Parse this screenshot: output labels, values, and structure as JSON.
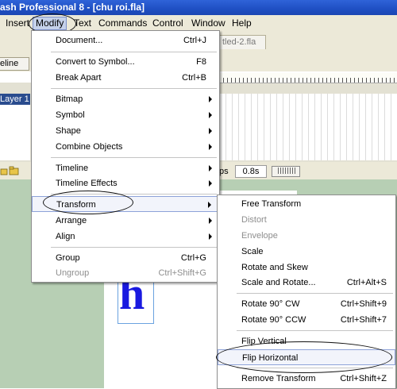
{
  "window": {
    "title": "ash Professional 8 - [chu roi.fla]"
  },
  "menubar": {
    "items": [
      "Insert",
      "Modify",
      "Text",
      "Commands",
      "Control",
      "Window",
      "Help"
    ],
    "active": "Modify"
  },
  "document_tab": "tled-2.fla",
  "timeline_button": "eline",
  "layer_label": "Layer 1",
  "status": {
    "fps_prefix": "ps",
    "fps_value": "0.8s"
  },
  "stage": {
    "letter": "h",
    "letter_color": "#1919e0"
  },
  "modify_menu": {
    "items": [
      {
        "label": "Document...",
        "shortcut": "Ctrl+J"
      },
      {
        "label": "Convert to Symbol...",
        "shortcut": "F8"
      },
      {
        "label": "Break Apart",
        "shortcut": "Ctrl+B"
      },
      {
        "label": "Bitmap",
        "submenu": true
      },
      {
        "label": "Symbol",
        "submenu": true
      },
      {
        "label": "Shape",
        "submenu": true
      },
      {
        "label": "Combine Objects",
        "submenu": true
      },
      {
        "label": "Timeline",
        "submenu": true
      },
      {
        "label": "Timeline Effects",
        "submenu": true
      },
      {
        "label": "Transform",
        "submenu": true,
        "highlighted": true
      },
      {
        "label": "Arrange",
        "submenu": true
      },
      {
        "label": "Align",
        "submenu": true
      },
      {
        "label": "Group",
        "shortcut": "Ctrl+G"
      },
      {
        "label": "Ungroup",
        "shortcut": "Ctrl+Shift+G",
        "disabled": true
      }
    ]
  },
  "transform_menu": {
    "items": [
      {
        "label": "Free Transform"
      },
      {
        "label": "Distort",
        "disabled": true
      },
      {
        "label": "Envelope",
        "disabled": true
      },
      {
        "label": "Scale"
      },
      {
        "label": "Rotate and Skew"
      },
      {
        "label": "Scale and Rotate...",
        "shortcut": "Ctrl+Alt+S"
      },
      {
        "label": "Rotate 90° CW",
        "shortcut": "Ctrl+Shift+9"
      },
      {
        "label": "Rotate 90° CCW",
        "shortcut": "Ctrl+Shift+7"
      },
      {
        "label": "Flip Vertical"
      },
      {
        "label": "Flip Horizontal",
        "highlighted": true
      },
      {
        "label": "Remove Transform",
        "shortcut": "Ctrl+Shift+Z"
      }
    ]
  },
  "colors": {
    "titlebar": "#2a5bd0",
    "highlight_border": "#8da2d8",
    "stage_bg": "#b7cfb4"
  }
}
